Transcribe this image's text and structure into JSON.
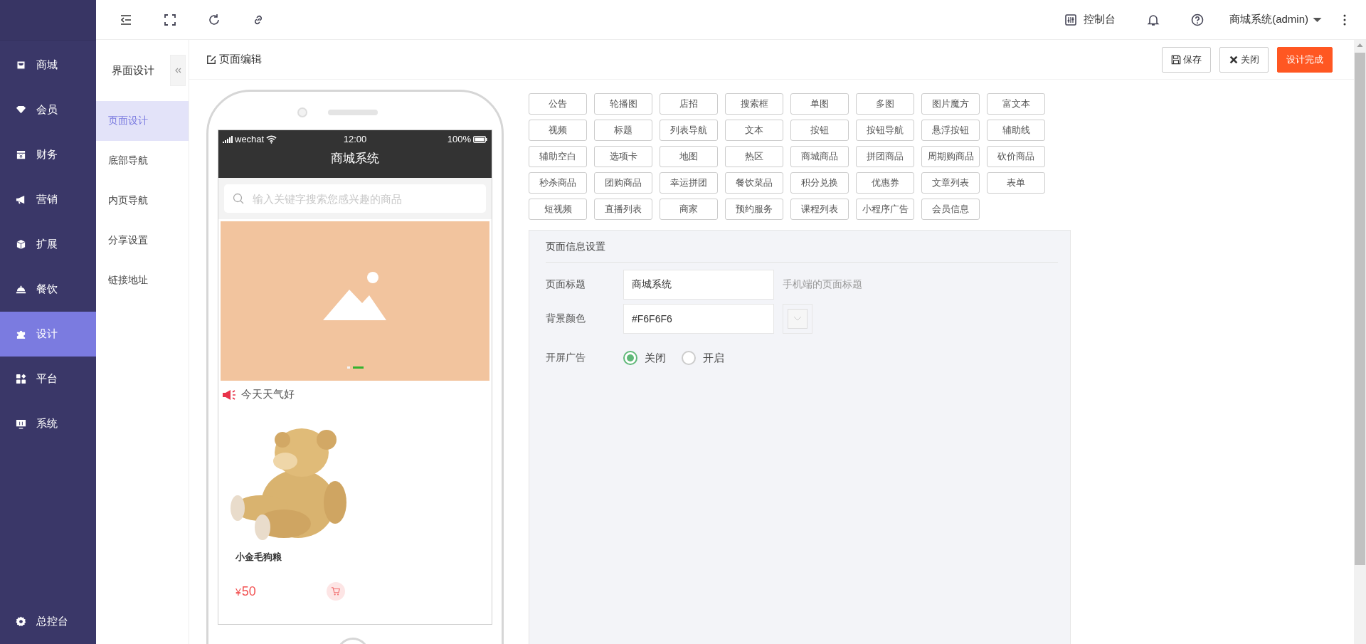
{
  "sidebar": {
    "items": [
      {
        "label": "商城",
        "selected": false
      },
      {
        "label": "会员",
        "selected": false
      },
      {
        "label": "财务",
        "selected": false
      },
      {
        "label": "营销",
        "selected": false
      },
      {
        "label": "扩展",
        "selected": false
      },
      {
        "label": "餐饮",
        "selected": false
      },
      {
        "label": "设计",
        "selected": true
      },
      {
        "label": "平台",
        "selected": false
      },
      {
        "label": "系统",
        "selected": false
      }
    ],
    "footer": "总控台"
  },
  "topbar": {
    "console": "控制台",
    "user": "商城系统(admin)"
  },
  "subnav": {
    "title": "界面设计",
    "items": [
      {
        "label": "页面设计",
        "selected": true
      },
      {
        "label": "底部导航",
        "selected": false
      },
      {
        "label": "内页导航",
        "selected": false
      },
      {
        "label": "分享设置",
        "selected": false
      },
      {
        "label": "链接地址",
        "selected": false
      }
    ]
  },
  "editor": {
    "title": "页面编辑",
    "buttons": [
      {
        "label": "保存",
        "kind": "save"
      },
      {
        "label": "关闭",
        "kind": "close"
      },
      {
        "label": "设计完成",
        "kind": "primary"
      }
    ]
  },
  "phone": {
    "carrier": "wechat",
    "time": "12:00",
    "battery": "100%",
    "title": "商城系统",
    "search_placeholder": "输入关键字搜索您感兴趣的商品",
    "slides": [
      {
        "selected": false
      },
      {
        "selected": true
      }
    ],
    "notice": "今天天气好",
    "product": {
      "name": "小金毛狗粮",
      "currency": "¥",
      "price": "50"
    }
  },
  "components": [
    "公告",
    "轮播图",
    "店招",
    "搜索框",
    "单图",
    "多图",
    "图片魔方",
    "富文本",
    "视频",
    "标题",
    "列表导航",
    "文本",
    "按钮",
    "按钮导航",
    "悬浮按钮",
    "辅助线",
    "辅助空白",
    "选项卡",
    "地图",
    "热区",
    "商城商品",
    "拼团商品",
    "周期购商品",
    "砍价商品",
    "秒杀商品",
    "团购商品",
    "幸运拼团",
    "餐饮菜品",
    "积分兑换",
    "优惠券",
    "文章列表",
    "表单",
    "短视频",
    "直播列表",
    "商家",
    "预约服务",
    "课程列表",
    "小程序广告",
    "会员信息"
  ],
  "settings": {
    "title": "页面信息设置",
    "fields": [
      {
        "label": "页面标题",
        "kind": "text",
        "value": "商城系统",
        "hint": "手机端的页面标题"
      },
      {
        "label": "背景颜色",
        "kind": "color",
        "value": "#F6F6F6"
      },
      {
        "label": "开屏广告",
        "kind": "radio",
        "options": [
          {
            "label": "关闭",
            "selected": true
          },
          {
            "label": "开启",
            "selected": false
          }
        ]
      }
    ]
  }
}
